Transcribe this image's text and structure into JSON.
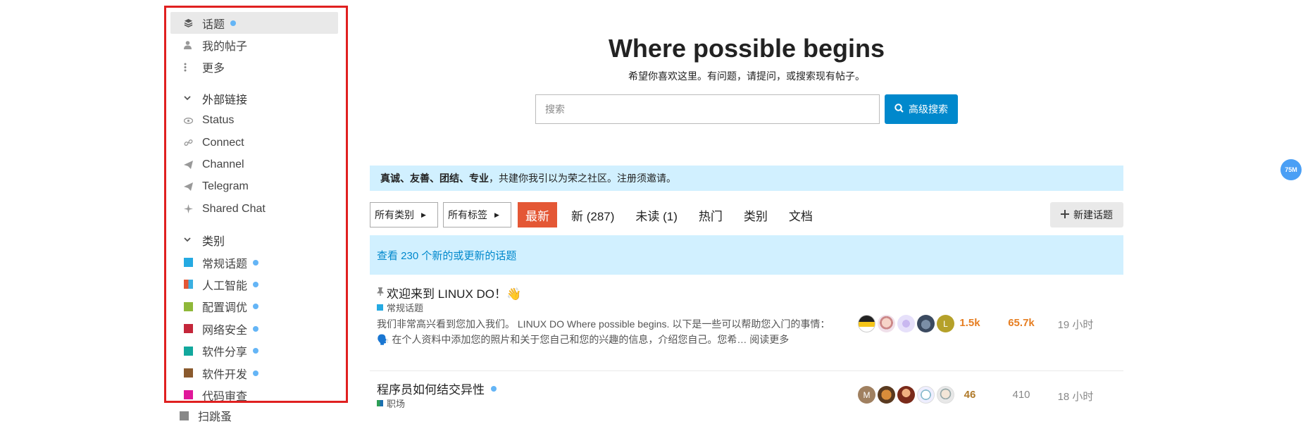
{
  "sidebar": {
    "top_items": [
      {
        "label": "话题",
        "icon": "layers-icon",
        "dot": true,
        "active": true
      },
      {
        "label": "我的帖子",
        "icon": "user-icon",
        "dot": false,
        "active": false
      },
      {
        "label": "更多",
        "icon": "ellipsis-vertical-icon",
        "dot": false,
        "active": false
      }
    ],
    "links_section": {
      "label": "外部链接",
      "icon": "chevron-down-icon"
    },
    "links": [
      {
        "label": "Status",
        "icon": "eye-icon"
      },
      {
        "label": "Connect",
        "icon": "link-icon"
      },
      {
        "label": "Channel",
        "icon": "paper-plane-icon"
      },
      {
        "label": "Telegram",
        "icon": "paper-plane-icon"
      },
      {
        "label": "Shared Chat",
        "icon": "sparkle-icon"
      }
    ],
    "categories_section": {
      "label": "类别",
      "icon": "chevron-down-icon"
    },
    "categories": [
      {
        "label": "常规话题",
        "color": "#25aae2"
      },
      {
        "label": "人工智能",
        "color": "split"
      },
      {
        "label": "配置调优",
        "color": "#8fb839"
      },
      {
        "label": "网络安全",
        "color": "#c4263a"
      },
      {
        "label": "软件分享",
        "color": "#12a89d"
      },
      {
        "label": "软件开发",
        "color": "#8a5a2e"
      },
      {
        "label": "代码审查",
        "color": "#e0179a"
      }
    ],
    "below_frame": {
      "label": "扫跳蚤"
    }
  },
  "hero": {
    "title": "Where possible begins",
    "subtitle": "希望你喜欢这里。有问题，请提问，或搜索现有帖子。",
    "search_placeholder": "搜索",
    "advanced_search": "高级搜索"
  },
  "banner": {
    "bold": "真诚、友善、团结、专业",
    "text": "，共建你我引以为荣之社区。注册须邀请。"
  },
  "nav": {
    "all_categories": "所有类别",
    "all_tags": "所有标签",
    "tabs": [
      "最新",
      "新 (287)",
      "未读 (1)",
      "热门",
      "类别",
      "文档"
    ],
    "new_topic": "新建话题"
  },
  "notice": "查看 230 个新的或更新的话题",
  "topics": [
    {
      "title": "欢迎来到 LINUX DO！👋",
      "pinned": true,
      "category": "常规话题",
      "category_color": "#25aae2",
      "excerpt": "我们非常高兴看到您加入我们。 LINUX DO Where possible begins. 以下是一些可以帮助您入门的事情： 🗣️ 在个人资料中添加您的照片和关于您自己和您的兴趣的信息，介绍您自己。您希… ",
      "read_more": "阅读更多",
      "posters": [
        "",
        "",
        "",
        "",
        "L"
      ],
      "replies": "1.5k",
      "views": "65.7k",
      "activity": "19 小时"
    },
    {
      "title": "程序员如何结交异性",
      "pinned": false,
      "category": "职场",
      "category_color": "#2d9f54",
      "posters": [
        "M",
        "",
        "",
        "",
        ""
      ],
      "replies": "46",
      "views": "410",
      "activity": "18 小时"
    }
  ],
  "memory_badge": "75M"
}
